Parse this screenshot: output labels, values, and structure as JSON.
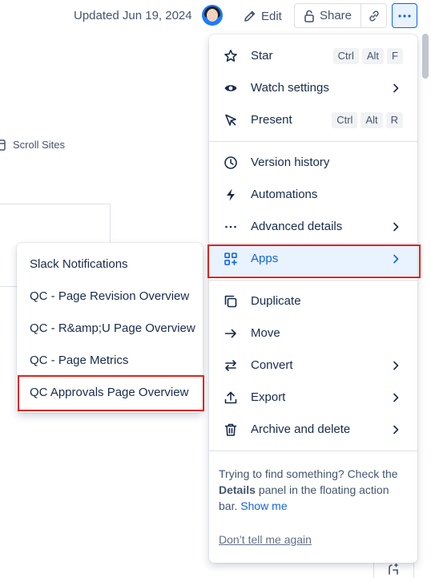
{
  "header": {
    "updated_text": "Updated Jun 19, 2024",
    "edit_label": "Edit",
    "share_label": "Share"
  },
  "background": {
    "scroll_sites_label": "Scroll Sites"
  },
  "menu": {
    "items": [
      {
        "label": "Star",
        "icon": "star-icon",
        "shortcut": [
          "Ctrl",
          "Alt",
          "F"
        ]
      },
      {
        "label": "Watch settings",
        "icon": "eye-icon"
      },
      {
        "label": "Present",
        "icon": "present-icon",
        "shortcut": [
          "Ctrl",
          "Alt",
          "R"
        ]
      },
      {
        "label": "Version history",
        "icon": "clock-icon"
      },
      {
        "label": "Automations",
        "icon": "lightning-icon"
      },
      {
        "label": "Advanced details",
        "icon": "ellipsis-icon"
      },
      {
        "label": "Apps",
        "icon": "apps-icon"
      },
      {
        "label": "Duplicate",
        "icon": "duplicate-icon"
      },
      {
        "label": "Move",
        "icon": "arrow-right-icon"
      },
      {
        "label": "Convert",
        "icon": "swap-icon"
      },
      {
        "label": "Export",
        "icon": "upload-icon"
      },
      {
        "label": "Archive and delete",
        "icon": "trash-icon"
      }
    ],
    "tip_prefix": "Trying to find something? Check the",
    "tip_bold": "Details",
    "tip_suffix": "panel in the floating action bar.",
    "tip_link": "Show me",
    "dismiss_label": "Don’t tell me again"
  },
  "submenu": {
    "items": [
      "Slack Notifications",
      "QC - Page Revision Overview",
      "QC - R&amp;U Page Overview",
      "QC - Page Metrics",
      "QC Approvals Page Overview"
    ]
  },
  "colors": {
    "accent": "#0c66e4",
    "highlight": "#e2231a",
    "active_bg": "#e9f2ff"
  }
}
